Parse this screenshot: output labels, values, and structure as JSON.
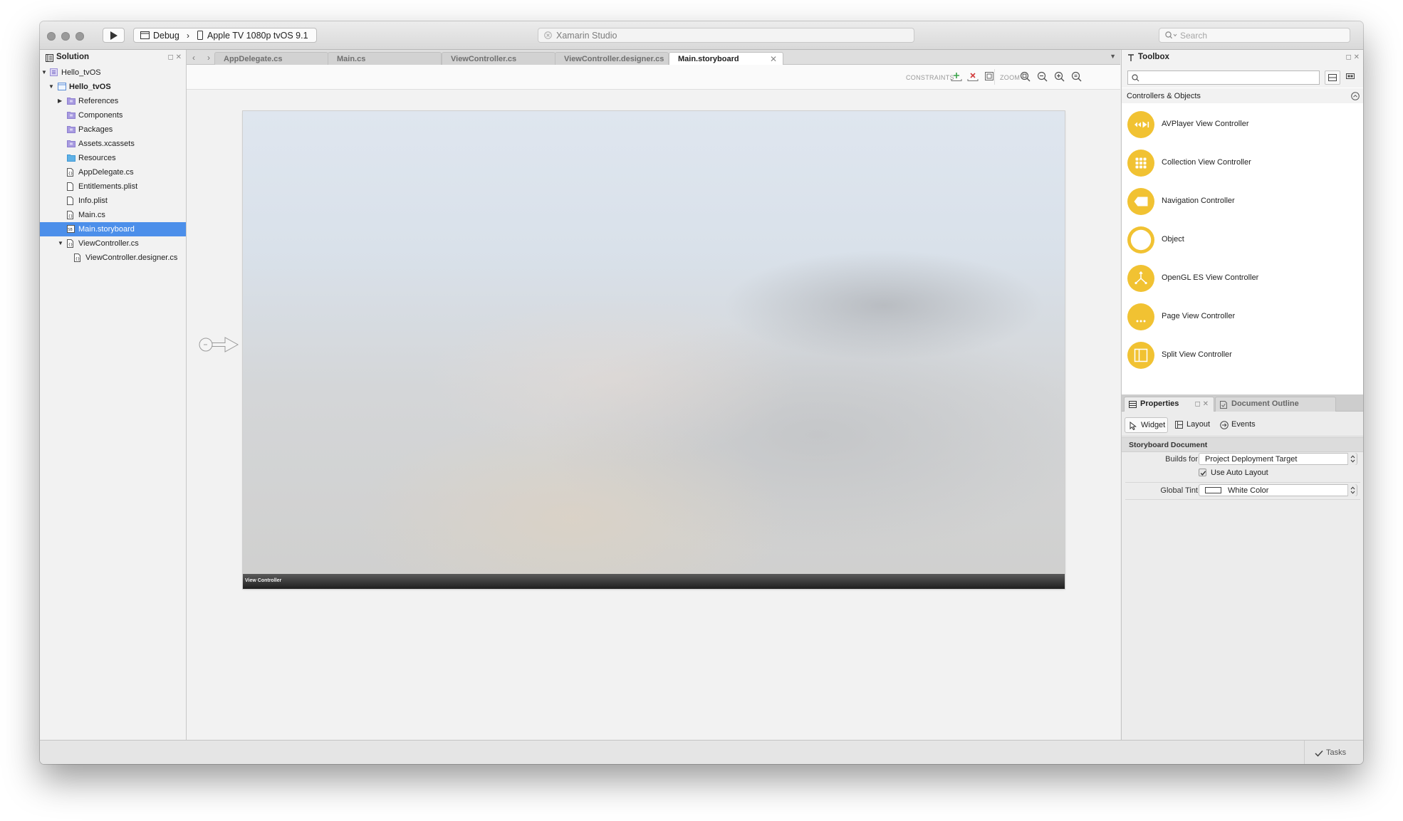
{
  "app": {
    "title": "Xamarin Studio"
  },
  "toolbar": {
    "config": "Debug",
    "device": "Apple TV 1080p tvOS 9.1",
    "search_placeholder": "Search"
  },
  "solution_pad": {
    "title": "Solution",
    "tree": [
      {
        "label": "Hello_tvOS",
        "depth": 0,
        "expander": "open",
        "icon": "solution-icon",
        "bold": false,
        "selected": false
      },
      {
        "label": "Hello_tvOS",
        "depth": 1,
        "expander": "open",
        "icon": "project-icon",
        "bold": true,
        "selected": false
      },
      {
        "label": "References",
        "depth": 2,
        "expander": "closed",
        "icon": "folder-purple-icon",
        "bold": false,
        "selected": false
      },
      {
        "label": "Components",
        "depth": 2,
        "expander": "none",
        "icon": "folder-purple-icon",
        "bold": false,
        "selected": false
      },
      {
        "label": "Packages",
        "depth": 2,
        "expander": "none",
        "icon": "folder-purple-icon",
        "bold": false,
        "selected": false
      },
      {
        "label": "Assets.xcassets",
        "depth": 2,
        "expander": "none",
        "icon": "folder-purple-icon",
        "bold": false,
        "selected": false
      },
      {
        "label": "Resources",
        "depth": 2,
        "expander": "none",
        "icon": "folder-blue-icon",
        "bold": false,
        "selected": false
      },
      {
        "label": "AppDelegate.cs",
        "depth": 2,
        "expander": "none",
        "icon": "cs-file-icon",
        "bold": false,
        "selected": false
      },
      {
        "label": "Entitlements.plist",
        "depth": 2,
        "expander": "none",
        "icon": "file-icon",
        "bold": false,
        "selected": false
      },
      {
        "label": "Info.plist",
        "depth": 2,
        "expander": "none",
        "icon": "file-icon",
        "bold": false,
        "selected": false
      },
      {
        "label": "Main.cs",
        "depth": 2,
        "expander": "none",
        "icon": "cs-file-icon",
        "bold": false,
        "selected": false
      },
      {
        "label": "Main.storyboard",
        "depth": 2,
        "expander": "none",
        "icon": "storyboard-file-icon",
        "bold": false,
        "selected": true
      },
      {
        "label": "ViewController.cs",
        "depth": 2,
        "expander": "open",
        "icon": "cs-file-icon",
        "bold": false,
        "selected": false
      },
      {
        "label": "ViewController.designer.cs",
        "depth": 3,
        "expander": "none",
        "icon": "cs-file-icon",
        "bold": false,
        "selected": false
      }
    ]
  },
  "editor": {
    "tabs": [
      {
        "label": "AppDelegate.cs",
        "active": false
      },
      {
        "label": "Main.cs",
        "active": false
      },
      {
        "label": "ViewController.cs",
        "active": false
      },
      {
        "label": "ViewController.designer.cs",
        "active": false
      },
      {
        "label": "Main.storyboard",
        "active": true
      }
    ],
    "constraints_label": "CONSTRAINTS",
    "zoom_label": "ZOOM",
    "scene_title": "View Controller"
  },
  "toolbox": {
    "title": "Toolbox",
    "category": "Controllers & Objects",
    "items": [
      {
        "label": "AVPlayer View Controller",
        "icon": "avplayer-icon"
      },
      {
        "label": "Collection View Controller",
        "icon": "collection-grid-icon"
      },
      {
        "label": "Navigation Controller",
        "icon": "navigation-icon"
      },
      {
        "label": "Object",
        "icon": "object-ring-icon"
      },
      {
        "label": "OpenGL ES View Controller",
        "icon": "opengl-icon"
      },
      {
        "label": "Page View Controller",
        "icon": "page-dots-icon"
      },
      {
        "label": "Split View Controller",
        "icon": "split-view-icon"
      }
    ]
  },
  "properties": {
    "tab_properties": "Properties",
    "tab_outline": "Document Outline",
    "subtabs": {
      "widget": "Widget",
      "layout": "Layout",
      "events": "Events"
    },
    "group": "Storyboard Document",
    "builds_for_label": "Builds for",
    "builds_for_value": "Project Deployment Target",
    "auto_layout_label": "Use Auto Layout",
    "auto_layout_checked": true,
    "global_tint_label": "Global Tint",
    "global_tint_value": "White Color"
  },
  "statusbar": {
    "tasks": "Tasks"
  },
  "colors": {
    "selection": "#4c8fea",
    "toolbox_accent": "#f1c232",
    "folder_purple": "#a89be0",
    "folder_blue": "#5fb1e6"
  }
}
